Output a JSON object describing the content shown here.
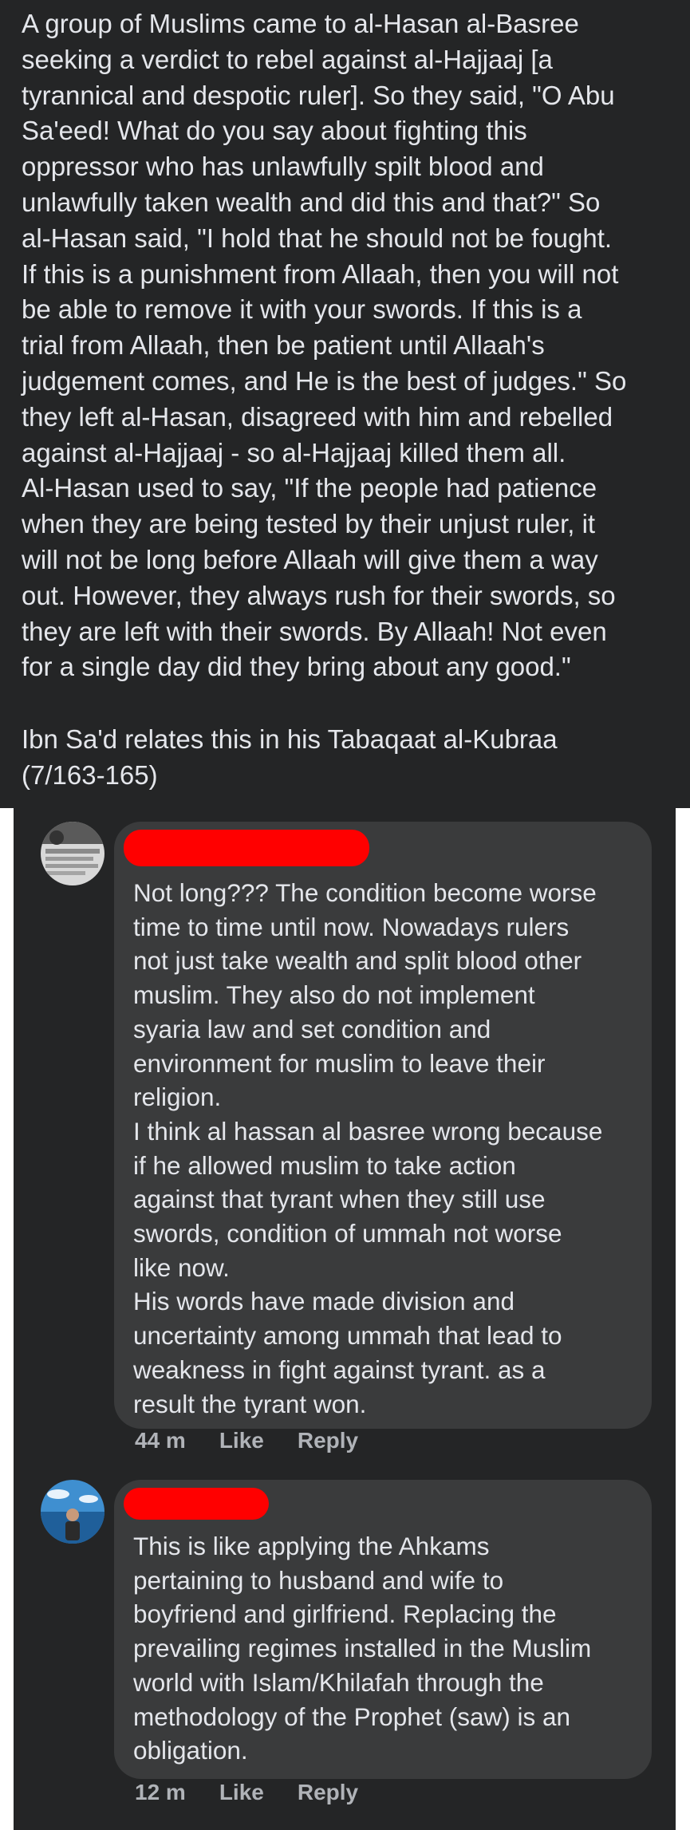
{
  "post": {
    "body": "A group of Muslims came to al-Hasan al-Basree\nseeking a verdict to rebel against al-Hajjaaj [a\ntyrannical and despotic ruler]. So they said, \"O Abu\nSa'eed! What do you say about fighting this\noppressor who has unlawfully spilt blood and\nunlawfully taken wealth and did this and that?\" So\nal-Hasan said, \"I hold that he should not be fought.\nIf this is a punishment from Allaah, then you will not\nbe able to remove it with your swords. If this is a\ntrial from Allaah, then be patient until Allaah's\njudgement comes, and He is the best of judges.\" So\nthey left al-Hasan, disagreed with him and rebelled\nagainst al-Hajjaaj - so al-Hajjaaj killed them all.\nAl-Hasan used to say, \"If the people had patience\nwhen they are being tested by their unjust ruler, it\nwill not be long before Allaah will give them a way\nout. However, they always rush for their swords, so\nthey are left with their swords. By Allaah! Not even\nfor a single day did they bring about any good.\"",
    "source": "Ibn Sa'd relates this in his Tabaqaat al-Kubraa\n(7/163-165)"
  },
  "comments": [
    {
      "text": "Not long??? The condition become worse\ntime to time until now. Nowadays rulers\nnot just take wealth and split blood other\nmuslim. They also do not implement\nsyaria law and set condition and\nenvironment for muslim to leave their\nreligion.\nI think al hassan al basree wrong because\nif he allowed muslim to take action\nagainst that tyrant when they still use\nswords, condition of ummah not worse\nlike now.\nHis words have made division and\nuncertainty among ummah that lead to\nweakness in fight against tyrant. as a\nresult the tyrant won.",
      "time": "44 m",
      "like_label": "Like",
      "reply_label": "Reply"
    },
    {
      "text": "This is like applying the Ahkams\npertaining to husband and wife to\nboyfriend and girlfriend. Replacing the\nprevailing regimes installed in the Muslim\nworld with Islam/Khilafah through the\nmethodology of the Prophet (saw) is an\nobligation.",
      "time": "12 m",
      "like_label": "Like",
      "reply_label": "Reply"
    }
  ],
  "colors": {
    "background": "#242526",
    "bubble": "#3a3b3c",
    "text": "#e4e6eb",
    "meta": "#b0b3b8",
    "redaction": "#ff0000"
  }
}
